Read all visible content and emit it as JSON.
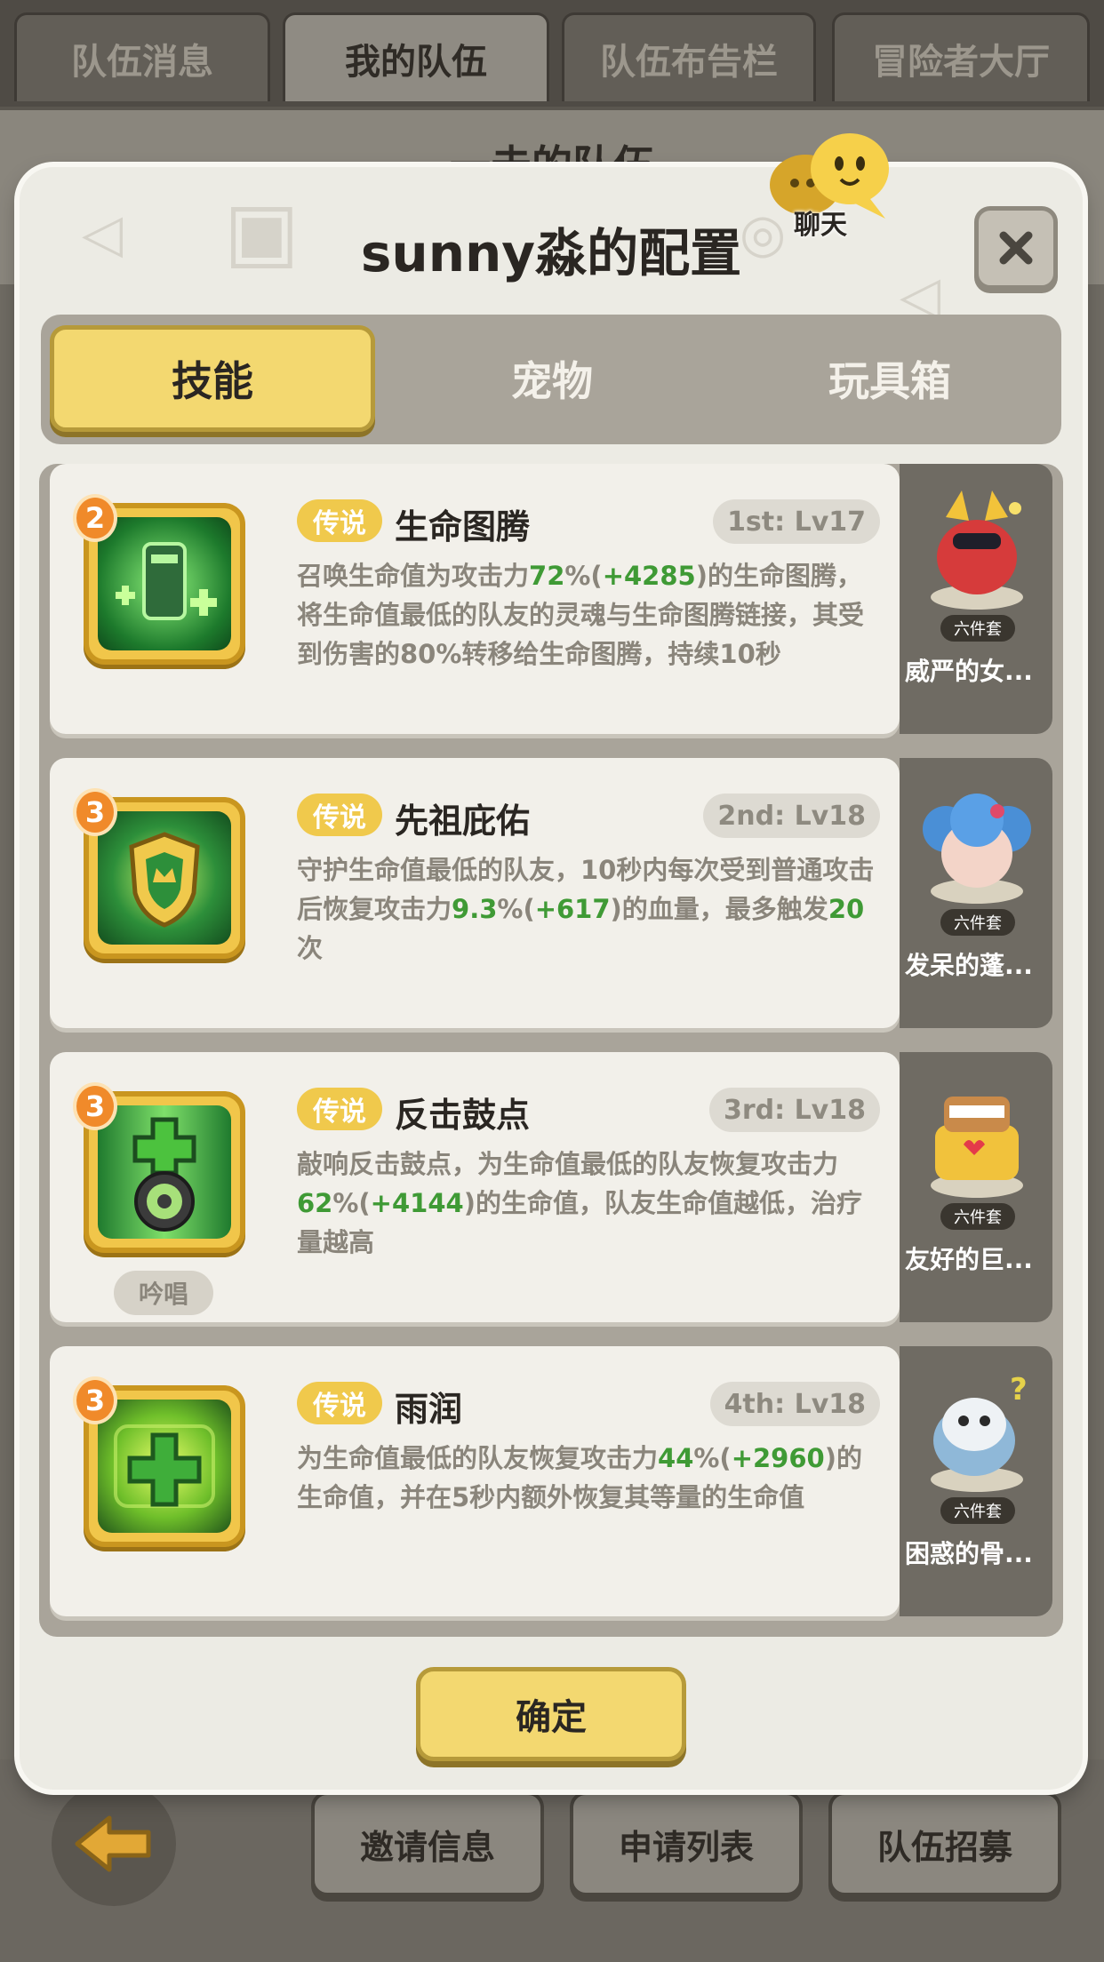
{
  "background": {
    "top_tabs": [
      {
        "label": "队伍消息",
        "active": false
      },
      {
        "label": "我的队伍",
        "active": true
      },
      {
        "label": "队伍布告栏",
        "active": false
      },
      {
        "label": "冒险者大厅",
        "active": false
      }
    ],
    "header_title": "一击的队伍",
    "bottom_buttons": [
      "邀请信息",
      "申请列表",
      "队伍招募"
    ]
  },
  "modal": {
    "title": "sunny淼的配置",
    "chat_label": "聊天",
    "tabs": [
      {
        "label": "技能",
        "active": true
      },
      {
        "label": "宠物",
        "active": false
      },
      {
        "label": "玩具箱",
        "active": false
      }
    ],
    "skills": [
      {
        "level": "2",
        "rarity": "传说",
        "name": "生命图腾",
        "slot": "1st: Lv17",
        "desc": [
          {
            "t": "召唤生命值为攻击力",
            "g": false
          },
          {
            "t": "72",
            "g": true
          },
          {
            "t": "%(",
            "g": false
          },
          {
            "t": "+4285",
            "g": true
          },
          {
            "t": ")的生命图腾，将生命值最低的队友的灵魂与生命图腾链接，其受到伤害的80%转移给生命图腾，持续10秒",
            "g": false
          }
        ],
        "chant": "",
        "icon": "totem-icon",
        "pet_name": "威严的女...",
        "pet_badge": "六件套",
        "pet_icon": "red-dragon-pet-icon"
      },
      {
        "level": "3",
        "rarity": "传说",
        "name": "先祖庇佑",
        "slot": "2nd: Lv18",
        "desc": [
          {
            "t": "守护生命值最低的队友，10秒内每次受到普通攻击后恢复攻击力",
            "g": false
          },
          {
            "t": "9.3",
            "g": true
          },
          {
            "t": "%(",
            "g": false
          },
          {
            "t": "+617",
            "g": true
          },
          {
            "t": ")的血量，最多触发",
            "g": false
          },
          {
            "t": "20",
            "g": true
          },
          {
            "t": "次",
            "g": false
          }
        ],
        "chant": "",
        "icon": "shield-icon",
        "pet_name": "发呆的蓬...",
        "pet_badge": "六件套",
        "pet_icon": "blue-sheep-pet-icon"
      },
      {
        "level": "3",
        "rarity": "传说",
        "name": "反击鼓点",
        "slot": "3rd: Lv18",
        "desc": [
          {
            "t": "敲响反击鼓点，为生命值最低的队友恢复攻击力",
            "g": false
          },
          {
            "t": "62",
            "g": true
          },
          {
            "t": "%(",
            "g": false
          },
          {
            "t": "+4144",
            "g": true
          },
          {
            "t": ")的生命值，队友生命值越低，治疗量越高",
            "g": false
          }
        ],
        "chant": "吟唱",
        "icon": "drum-icon",
        "pet_name": "友好的巨...",
        "pet_badge": "六件套",
        "pet_icon": "giant-pet-icon"
      },
      {
        "level": "3",
        "rarity": "传说",
        "name": "雨润",
        "slot": "4th: Lv18",
        "desc": [
          {
            "t": "为生命值最低的队友恢复攻击力",
            "g": false
          },
          {
            "t": "44",
            "g": true
          },
          {
            "t": "%(",
            "g": false
          },
          {
            "t": "+2960",
            "g": true
          },
          {
            "t": ")的生命值，并在5秒内额外恢复其等量的生命值",
            "g": false
          }
        ],
        "chant": "",
        "icon": "rain-heal-icon",
        "pet_name": "困惑的骨...",
        "pet_badge": "六件套",
        "pet_icon": "bone-dragon-pet-icon"
      }
    ],
    "confirm_label": "确定"
  }
}
